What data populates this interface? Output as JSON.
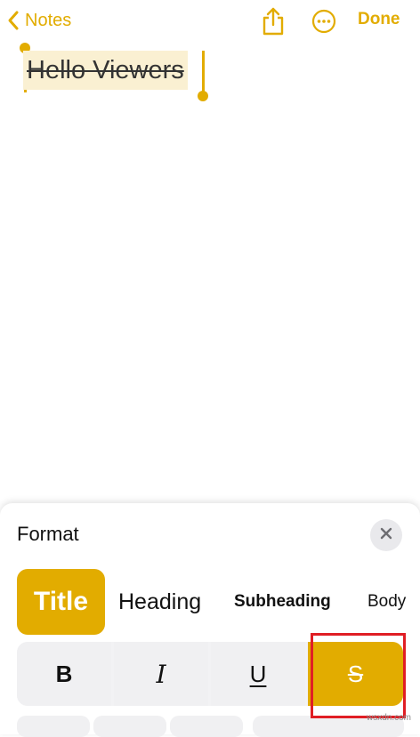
{
  "topbar": {
    "back_label": "Notes",
    "done_label": "Done",
    "back_icon": "chevron-left-icon",
    "share_icon": "share-icon",
    "more_icon": "ellipsis-circle-icon"
  },
  "note": {
    "text": "Hello Viewers"
  },
  "format_panel": {
    "title": "Format",
    "close_icon": "close-icon",
    "styles": [
      "Title",
      "Heading",
      "Subheading",
      "Body"
    ],
    "selected_style": "Title",
    "buttons": {
      "bold": "B",
      "italic": "I",
      "underline": "U",
      "strikethrough": "S"
    },
    "active_button": "strikethrough"
  },
  "watermark": "wsxdn.com",
  "colors": {
    "accent": "#e2ac00",
    "highlight_border": "#e01e24",
    "selection_bg": "#faf0d2"
  }
}
